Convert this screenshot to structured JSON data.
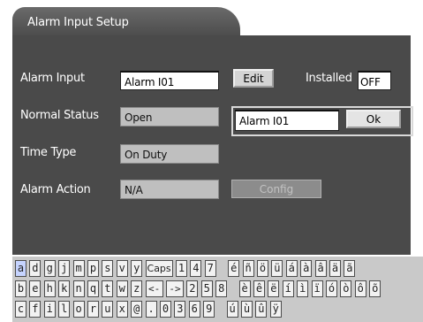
{
  "window": {
    "title": "Alarm Input Setup"
  },
  "form": {
    "alarm_input_label": "Alarm Input",
    "alarm_input_value": "Alarm I01",
    "edit_button": "Edit",
    "installed_label": "Installed",
    "installed_value": "OFF",
    "normal_status_label": "Normal Status",
    "normal_status_value": "Open",
    "time_type_label": "Time Type",
    "time_type_value": "On Duty",
    "alarm_action_label": "Alarm Action",
    "alarm_action_value": "N/A",
    "config_button": "Config"
  },
  "popup": {
    "input_value": "Alarm I01",
    "ok_button": "Ok"
  },
  "keyboard": {
    "rows": [
      [
        "a",
        "d",
        "g",
        "j",
        "m",
        "p",
        "s",
        "v",
        "y",
        "Caps",
        "1",
        "4",
        "7",
        "é",
        "ñ",
        "ö",
        "ü",
        "á",
        "à",
        "â",
        "ä",
        "ã"
      ],
      [
        "b",
        "e",
        "h",
        "k",
        "n",
        "q",
        "t",
        "w",
        "z",
        "<-",
        "->",
        "2",
        "5",
        "8",
        "è",
        "ê",
        "ë",
        "í",
        "ì",
        "ï",
        "ó",
        "ò",
        "ô",
        "õ"
      ],
      [
        "c",
        "f",
        "i",
        "l",
        "o",
        "r",
        "u",
        "x",
        "@",
        ".",
        "0",
        "3",
        "6",
        "9",
        "ú",
        "ù",
        "û",
        "ÿ"
      ]
    ],
    "highlighted": "a"
  }
}
